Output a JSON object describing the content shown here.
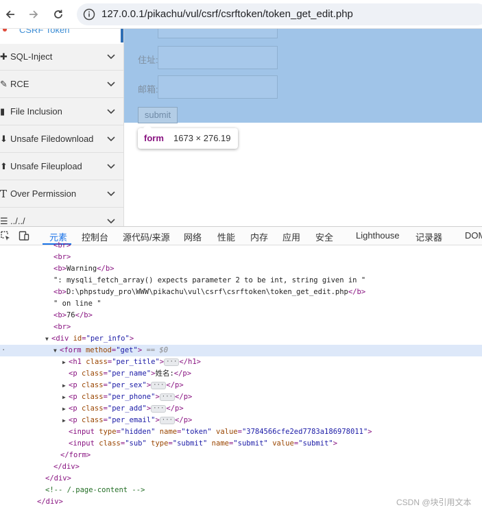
{
  "browser": {
    "url": "127.0.0.1/pikachu/vul/csrf/csrftoken/token_get_edit.php"
  },
  "sidebar": {
    "active_item": "CSRF Token",
    "items": [
      {
        "label": "SQL-Inject",
        "icon": "puzzle-icon"
      },
      {
        "label": "RCE",
        "icon": "pencil-icon"
      },
      {
        "label": "File Inclusion",
        "icon": "file-icon"
      },
      {
        "label": "Unsafe Filedownload",
        "icon": "download-icon"
      },
      {
        "label": "Unsafe Fileupload",
        "icon": "upload-icon"
      },
      {
        "label": "Over Permission",
        "icon": "text-t-icon"
      },
      {
        "label": "../../",
        "icon": "list-icon"
      }
    ]
  },
  "form": {
    "address_label": "住址:",
    "email_label": "邮箱:",
    "submit_label": "submit"
  },
  "tooltip": {
    "tag": "form",
    "dimensions": "1673 × 276.19"
  },
  "devtools": {
    "tabs": [
      "元素",
      "控制台",
      "源代码/来源",
      "网络",
      "性能",
      "内存",
      "应用",
      "安全",
      "Lighthouse",
      "记录器",
      "DOM"
    ],
    "active_tab": "元素",
    "lines": {
      "l0": "<br>",
      "l1": "<br>",
      "l2_open": "<b>",
      "l2_text": "Warning",
      "l2_close": "</b>",
      "l3": "\": mysqli_fetch_array() expects parameter 2 to be int, string given in \"",
      "l4_text": "D:\\phpstudy_pro\\WWW\\pikachu\\vul\\csrf\\csrftoken\\token_get_edit.php",
      "l5": "\" on line \"",
      "l6_text": "76",
      "l7": "<br>",
      "l8_val": "\"per_info\"",
      "l9_val": "\"get\"",
      "l9_suffix": "== $0",
      "l10_val": "\"per_title\"",
      "l11_val": "\"per_name\"",
      "l11_text": "姓名:",
      "l12_val": "\"per_sex\"",
      "l13_val": "\"per_phone\"",
      "l14_val": "\"per_add\"",
      "l15_val": "\"per_email\"",
      "l16_type": "\"hidden\"",
      "l16_name": "\"token\"",
      "l16_value": "\"3784566cfe2ed7783a186978011\"",
      "l17_class": "\"sub\"",
      "l17_type": "\"submit\"",
      "l17_name": "\"submit\"",
      "l17_value": "\"submit\"",
      "l21_comment": "<!-- /.page-content -->"
    }
  },
  "watermark": "CSDN @块引用文本"
}
